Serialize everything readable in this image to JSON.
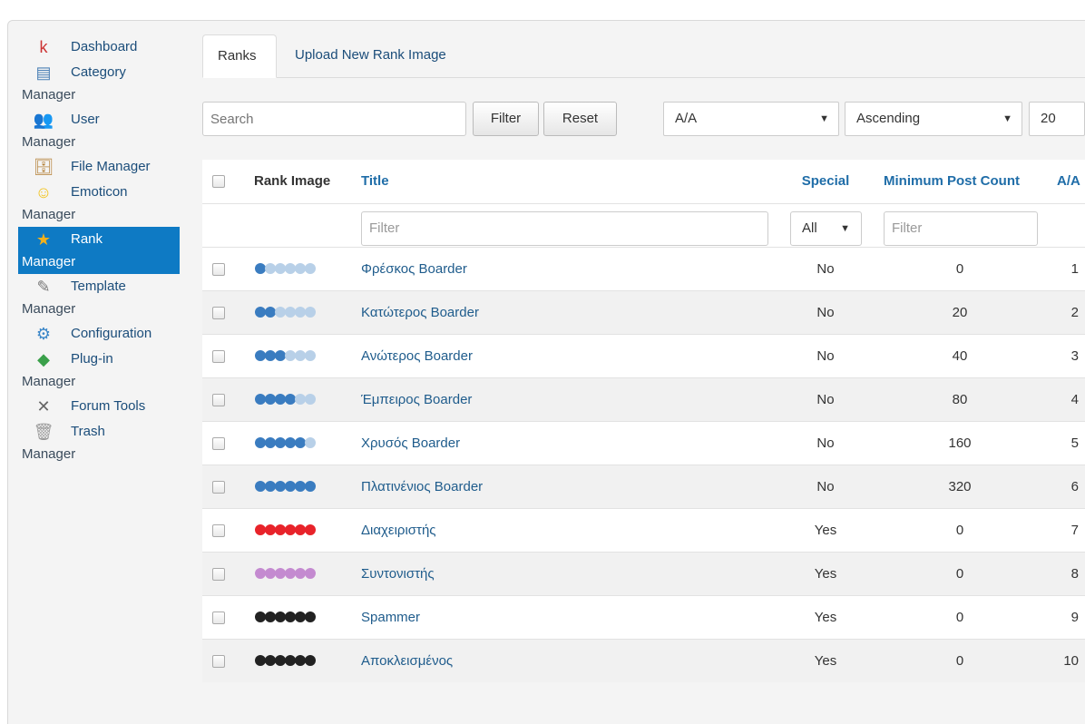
{
  "sidebar": {
    "items": [
      {
        "line1": "Dashboard",
        "line2": "",
        "icon": "k-logo-icon"
      },
      {
        "line1": "Category",
        "line2": "Manager",
        "icon": "category-icon"
      },
      {
        "line1": "User",
        "line2": "Manager",
        "icon": "users-icon"
      },
      {
        "line1": "File Manager",
        "line2": "",
        "icon": "file-manager-icon"
      },
      {
        "line1": "Emoticon",
        "line2": "Manager",
        "icon": "smiley-icon"
      },
      {
        "line1": "Rank",
        "line2": "Manager",
        "icon": "star-icon"
      },
      {
        "line1": "Template",
        "line2": "Manager",
        "icon": "template-icon"
      },
      {
        "line1": "Configuration",
        "line2": "",
        "icon": "configuration-icon"
      },
      {
        "line1": "Plug-in",
        "line2": "Manager",
        "icon": "plugin-icon"
      },
      {
        "line1": "Forum Tools",
        "line2": "",
        "icon": "tools-icon"
      },
      {
        "line1": "Trash",
        "line2": "Manager",
        "icon": "trash-icon"
      }
    ],
    "active_index": 5
  },
  "tabs": {
    "ranks": "Ranks",
    "upload": "Upload New Rank Image"
  },
  "toolbar": {
    "search_placeholder": "Search",
    "filter_label": "Filter",
    "reset_label": "Reset",
    "order_by_value": "A/A",
    "direction_value": "Ascending",
    "limit_value": "20"
  },
  "table": {
    "headers": {
      "rank_image": "Rank Image",
      "title": "Title",
      "special": "Special",
      "min_posts": "Minimum Post Count",
      "order": "A/A"
    },
    "filters": {
      "title_placeholder": "Filter",
      "special_value": "All",
      "count_placeholder": "Filter"
    },
    "rows": [
      {
        "title": "Φρέσκος Boarder",
        "special": "No",
        "min_posts": "0",
        "order": "1",
        "filled": 1,
        "color": "#3a7cc0",
        "empty_color": "#b8d0e8"
      },
      {
        "title": "Κατώτερος Boarder",
        "special": "No",
        "min_posts": "20",
        "order": "2",
        "filled": 2,
        "color": "#3a7cc0",
        "empty_color": "#b8d0e8"
      },
      {
        "title": "Ανώτερος Boarder",
        "special": "No",
        "min_posts": "40",
        "order": "3",
        "filled": 3,
        "color": "#3a7cc0",
        "empty_color": "#b8d0e8"
      },
      {
        "title": "Έμπειρος Boarder",
        "special": "No",
        "min_posts": "80",
        "order": "4",
        "filled": 4,
        "color": "#3a7cc0",
        "empty_color": "#b8d0e8"
      },
      {
        "title": "Χρυσός Boarder",
        "special": "No",
        "min_posts": "160",
        "order": "5",
        "filled": 5,
        "color": "#3a7cc0",
        "empty_color": "#b8d0e8"
      },
      {
        "title": "Πλατινένιος Boarder",
        "special": "No",
        "min_posts": "320",
        "order": "6",
        "filled": 6,
        "color": "#3a7cc0",
        "empty_color": "#b8d0e8"
      },
      {
        "title": "Διαχειριστής",
        "special": "Yes",
        "min_posts": "0",
        "order": "7",
        "filled": 6,
        "color": "#e8232a",
        "empty_color": "#e8232a"
      },
      {
        "title": "Συντονιστής",
        "special": "Yes",
        "min_posts": "0",
        "order": "8",
        "filled": 6,
        "color": "#c48ad0",
        "empty_color": "#c48ad0"
      },
      {
        "title": "Spammer",
        "special": "Yes",
        "min_posts": "0",
        "order": "9",
        "filled": 6,
        "color": "#222222",
        "empty_color": "#222222"
      },
      {
        "title": "Αποκλεισμένος",
        "special": "Yes",
        "min_posts": "0",
        "order": "10",
        "filled": 6,
        "color": "#222222",
        "empty_color": "#222222"
      }
    ]
  },
  "colors": {
    "accent": "#0e7ac4",
    "link": "#1f5c8c"
  }
}
